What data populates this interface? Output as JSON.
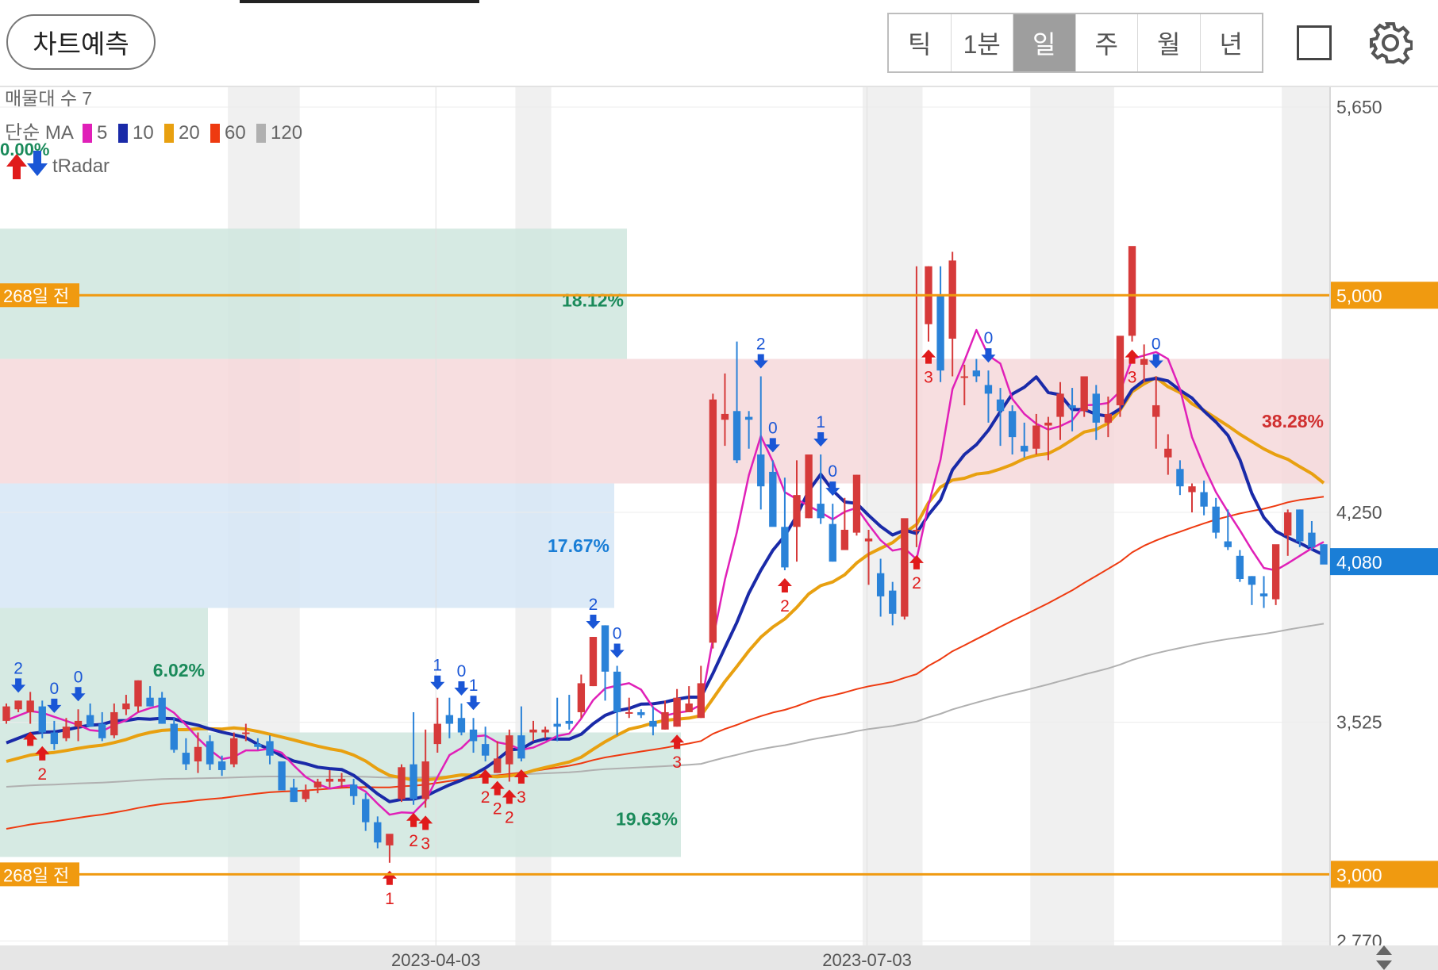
{
  "toolbar": {
    "predict_label": "차트예측",
    "periods": [
      "틱",
      "1분",
      "일",
      "주",
      "월",
      "년"
    ],
    "active_period": "일"
  },
  "legend": {
    "volume_profile_label": "매물대 수 7",
    "ma_prefix": "단순 MA",
    "ma_items": [
      {
        "label": "5",
        "color": "#e020b8"
      },
      {
        "label": "10",
        "color": "#1a2aa8"
      },
      {
        "label": "20",
        "color": "#e8a010"
      },
      {
        "label": "60",
        "color": "#ee3a10"
      },
      {
        "label": "120",
        "color": "#b0b0b0"
      }
    ],
    "radar_label": "tRadar",
    "radar_pct": "0.00%"
  },
  "chart_data": {
    "type": "candlestick",
    "y_axis": {
      "ticks": [
        5650,
        5000,
        4250,
        3525,
        2770
      ],
      "ylim": [
        2760,
        5680
      ]
    },
    "x_axis": {
      "labels": [
        "2023-04-03",
        "2023-07-03"
      ]
    },
    "current_price": {
      "label": "4,080",
      "value": 4080
    },
    "price_lines": [
      {
        "value": 5000,
        "axis_label": "5,000",
        "tag": "268일 전"
      },
      {
        "value": 3000,
        "axis_label": "3,000",
        "tag": "268일 전"
      }
    ],
    "volume_zones": [
      {
        "label": "18.12%",
        "y_low": 4780,
        "y_high": 5230,
        "color": "#cfe6de"
      },
      {
        "label": "38.28%",
        "y_low": 4350,
        "y_high": 4780,
        "color": "#f6d8da"
      },
      {
        "label": "17.67%",
        "y_low": 3920,
        "y_high": 4350,
        "color": "#d6e6f6"
      },
      {
        "label": "6.02%",
        "y_low": 3490,
        "y_high": 3920,
        "color": "#cfe6de"
      },
      {
        "label": "19.63%",
        "y_low": 3060,
        "y_high": 3490,
        "color": "#cfe6de"
      }
    ],
    "candles": [
      [
        3530,
        3590,
        3520,
        3580
      ],
      [
        3570,
        3600,
        3560,
        3600
      ],
      [
        3560,
        3630,
        3520,
        3600
      ],
      [
        3580,
        3600,
        3470,
        3490
      ],
      [
        3490,
        3530,
        3430,
        3450
      ],
      [
        3470,
        3540,
        3460,
        3510
      ],
      [
        3510,
        3570,
        3460,
        3530
      ],
      [
        3550,
        3590,
        3510,
        3510
      ],
      [
        3520,
        3560,
        3460,
        3470
      ],
      [
        3480,
        3590,
        3470,
        3560
      ],
      [
        3570,
        3620,
        3550,
        3590
      ],
      [
        3580,
        3670,
        3560,
        3670
      ],
      [
        3610,
        3650,
        3580,
        3580
      ],
      [
        3610,
        3630,
        3520,
        3520
      ],
      [
        3520,
        3540,
        3420,
        3430
      ],
      [
        3420,
        3470,
        3360,
        3380
      ],
      [
        3390,
        3490,
        3350,
        3440
      ],
      [
        3460,
        3480,
        3360,
        3380
      ],
      [
        3390,
        3410,
        3340,
        3360
      ],
      [
        3380,
        3490,
        3370,
        3470
      ],
      [
        3490,
        3520,
        3460,
        3490
      ],
      [
        3450,
        3470,
        3430,
        3440
      ],
      [
        3460,
        3480,
        3380,
        3410
      ],
      [
        3390,
        3390,
        3290,
        3290
      ],
      [
        3300,
        3330,
        3250,
        3250
      ],
      [
        3260,
        3310,
        3250,
        3290
      ],
      [
        3300,
        3330,
        3280,
        3320
      ],
      [
        3320,
        3360,
        3300,
        3330
      ],
      [
        3320,
        3350,
        3300,
        3330
      ],
      [
        3310,
        3330,
        3240,
        3270
      ],
      [
        3260,
        3280,
        3150,
        3180
      ],
      [
        3180,
        3200,
        3090,
        3110
      ],
      [
        3100,
        3130,
        3040,
        3140
      ],
      [
        3260,
        3380,
        3250,
        3370
      ],
      [
        3380,
        3560,
        3240,
        3260
      ],
      [
        3260,
        3500,
        3230,
        3390
      ],
      [
        3450,
        3610,
        3420,
        3520
      ],
      [
        3550,
        3610,
        3470,
        3520
      ],
      [
        3540,
        3590,
        3480,
        3490
      ],
      [
        3500,
        3540,
        3420,
        3460
      ],
      [
        3450,
        3510,
        3390,
        3410
      ],
      [
        3350,
        3460,
        3350,
        3400
      ],
      [
        3380,
        3500,
        3320,
        3480
      ],
      [
        3480,
        3580,
        3390,
        3400
      ],
      [
        3490,
        3530,
        3460,
        3500
      ],
      [
        3490,
        3510,
        3470,
        3500
      ],
      [
        3520,
        3610,
        3460,
        3510
      ],
      [
        3530,
        3620,
        3500,
        3520
      ],
      [
        3560,
        3690,
        3540,
        3660
      ],
      [
        3650,
        3820,
        3650,
        3820
      ],
      [
        3860,
        3860,
        3600,
        3700
      ],
      [
        3700,
        3720,
        3480,
        3560
      ],
      [
        3560,
        3610,
        3540,
        3560
      ],
      [
        3560,
        3570,
        3540,
        3550
      ],
      [
        3530,
        3580,
        3480,
        3510
      ],
      [
        3500,
        3600,
        3500,
        3560
      ],
      [
        3510,
        3640,
        3510,
        3610
      ],
      [
        3560,
        3650,
        3560,
        3590
      ],
      [
        3540,
        3720,
        3540,
        3660
      ],
      [
        3800,
        4660,
        3780,
        4640
      ],
      [
        4570,
        4730,
        4480,
        4590
      ],
      [
        4600,
        4840,
        4420,
        4430
      ],
      [
        4580,
        4600,
        4470,
        4570
      ],
      [
        4450,
        4720,
        4260,
        4340
      ],
      [
        4390,
        4430,
        4230,
        4200
      ],
      [
        4200,
        4370,
        4050,
        4060
      ],
      [
        4200,
        4430,
        4080,
        4310
      ],
      [
        4230,
        4440,
        4230,
        4450
      ],
      [
        4280,
        4450,
        4210,
        4230
      ],
      [
        4210,
        4280,
        4080,
        4080
      ],
      [
        4120,
        4300,
        4120,
        4190
      ],
      [
        4180,
        4380,
        4170,
        4380
      ],
      [
        4150,
        4190,
        4000,
        4160
      ],
      [
        4040,
        4090,
        3890,
        3960
      ],
      [
        3980,
        4010,
        3860,
        3900
      ],
      [
        3890,
        4110,
        3880,
        4230
      ],
      [
        4190,
        5100,
        4130,
        4190
      ],
      [
        4900,
        5100,
        4840,
        5100
      ],
      [
        5000,
        5100,
        4700,
        4740
      ],
      [
        4850,
        5150,
        4720,
        5120
      ],
      [
        4720,
        4760,
        4620,
        4720
      ],
      [
        4740,
        4780,
        4700,
        4720
      ],
      [
        4690,
        4740,
        4560,
        4660
      ],
      [
        4640,
        4680,
        4480,
        4600
      ],
      [
        4600,
        4620,
        4450,
        4510
      ],
      [
        4480,
        4560,
        4440,
        4460
      ],
      [
        4470,
        4590,
        4450,
        4550
      ],
      [
        4550,
        4580,
        4430,
        4560
      ],
      [
        4580,
        4700,
        4500,
        4660
      ],
      [
        4620,
        4680,
        4530,
        4610
      ],
      [
        4600,
        4710,
        4580,
        4720
      ],
      [
        4660,
        4690,
        4500,
        4560
      ],
      [
        4560,
        4650,
        4510,
        4590
      ],
      [
        4620,
        4780,
        4580,
        4860
      ],
      [
        4860,
        5150,
        4840,
        5170
      ],
      [
        4760,
        4830,
        4700,
        4780
      ],
      [
        4580,
        4720,
        4470,
        4620
      ],
      [
        4440,
        4520,
        4380,
        4470
      ],
      [
        4400,
        4430,
        4310,
        4340
      ],
      [
        4320,
        4350,
        4250,
        4340
      ],
      [
        4320,
        4360,
        4240,
        4270
      ],
      [
        4270,
        4300,
        4160,
        4180
      ],
      [
        4150,
        4260,
        4120,
        4130
      ],
      [
        4100,
        4120,
        4010,
        4020
      ],
      [
        4030,
        4030,
        3930,
        4000
      ],
      [
        3970,
        4030,
        3920,
        3960
      ],
      [
        3950,
        4130,
        3930,
        4140
      ],
      [
        4170,
        4260,
        4100,
        4250
      ],
      [
        4260,
        4260,
        4130,
        4150
      ],
      [
        4180,
        4220,
        4120,
        4130
      ],
      [
        4140,
        4140,
        4090,
        4070
      ]
    ],
    "signals": [
      {
        "i": 1,
        "dir": "down",
        "label": "2"
      },
      {
        "i": 4,
        "dir": "down",
        "label": "0"
      },
      {
        "i": 6,
        "dir": "down",
        "label": "0"
      },
      {
        "i": 3,
        "dir": "up",
        "label": "2"
      },
      {
        "i": 2,
        "dir": "up",
        "label": ""
      },
      {
        "i": 32,
        "dir": "up",
        "label": "1"
      },
      {
        "i": 34,
        "dir": "up",
        "label": "2"
      },
      {
        "i": 35,
        "dir": "up",
        "label": "3"
      },
      {
        "i": 36,
        "dir": "down",
        "label": "1"
      },
      {
        "i": 38,
        "dir": "down",
        "label": "0"
      },
      {
        "i": 39,
        "dir": "down",
        "label": "1"
      },
      {
        "i": 40,
        "dir": "up",
        "label": "2"
      },
      {
        "i": 41,
        "dir": "up",
        "label": "2"
      },
      {
        "i": 42,
        "dir": "up",
        "label": "2"
      },
      {
        "i": 43,
        "dir": "up",
        "label": "3"
      },
      {
        "i": 49,
        "dir": "down",
        "label": "2"
      },
      {
        "i": 51,
        "dir": "down",
        "label": "0"
      },
      {
        "i": 56,
        "dir": "up",
        "label": "3"
      },
      {
        "i": 63,
        "dir": "down",
        "label": "2"
      },
      {
        "i": 64,
        "dir": "down",
        "label": "0"
      },
      {
        "i": 65,
        "dir": "up",
        "label": "2"
      },
      {
        "i": 68,
        "dir": "down",
        "label": "1"
      },
      {
        "i": 69,
        "dir": "down",
        "label": "0"
      },
      {
        "i": 76,
        "dir": "up",
        "label": "2"
      },
      {
        "i": 77,
        "dir": "up",
        "label": "3"
      },
      {
        "i": 82,
        "dir": "down",
        "label": "0"
      },
      {
        "i": 94,
        "dir": "up",
        "label": "3"
      },
      {
        "i": 96,
        "dir": "down",
        "label": "0"
      }
    ]
  }
}
